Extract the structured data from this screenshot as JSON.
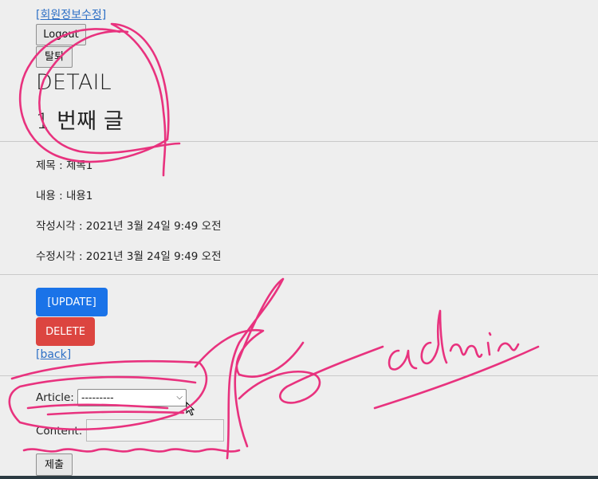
{
  "header": {
    "edit_profile_link": "[회원정보수정]",
    "logout_button": "Logout",
    "withdraw_button": "탈퇴"
  },
  "page": {
    "title": "DETAIL",
    "subtitle": "1 번째 글"
  },
  "article": {
    "title_row": "제목 : 제목1",
    "content_row": "내용 : 내용1",
    "created_row": "작성시각 : 2021년 3월 24일 9:49 오전",
    "updated_row": "수정시각 : 2021년 3월 24일 9:49 오전"
  },
  "actions": {
    "update_button": "[UPDATE]",
    "delete_button": "DELETE",
    "back_link": "[back]"
  },
  "comment_form": {
    "article_label": "Article:",
    "article_selected": "---------",
    "content_label": "Content:",
    "content_value": "",
    "submit_button": "제출"
  },
  "annotation": {
    "handwritten_text": "admin",
    "ink_color": "#e8327e"
  }
}
